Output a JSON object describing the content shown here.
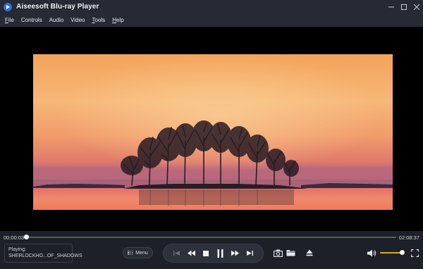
{
  "window": {
    "title": "Aiseesoft Blu-ray Player",
    "logo_icon": "play-logo-icon",
    "controls": [
      "minimize-icon",
      "maximize-icon",
      "close-icon"
    ]
  },
  "menu": {
    "items": [
      {
        "label": "File",
        "mnemonic": "F",
        "rest": "ile"
      },
      {
        "label": "Controls",
        "mnemonic": "",
        "rest": "Controls"
      },
      {
        "label": "Audio",
        "mnemonic": "",
        "rest": "Audio"
      },
      {
        "label": "Video",
        "mnemonic": "",
        "rest": "Video"
      },
      {
        "label": "Tools",
        "mnemonic": "T",
        "rest": "ools"
      },
      {
        "label": "Help",
        "mnemonic": "H",
        "rest": "elp"
      }
    ]
  },
  "playback": {
    "current_time": "00:00:03",
    "total_time": "02:08:37",
    "progress_fraction": 0.0004
  },
  "status": {
    "playing_label": "Playing:",
    "file_name": "SHERLOCKHO...OF_SHADOWS"
  },
  "controls": {
    "menu_label": "Menu",
    "transport_icons": [
      "skip-previous-icon",
      "rewind-icon",
      "stop-icon",
      "pause-icon",
      "fast-forward-icon",
      "skip-next-icon"
    ],
    "snapshot_icon": "camera-icon",
    "open_icon": "folder-icon",
    "eject_icon": "eject-icon",
    "volume_icon": "speaker-icon",
    "fullscreen_icon": "fullscreen-icon",
    "volume_fraction": 0.92,
    "accent_color": "#e0a826"
  }
}
